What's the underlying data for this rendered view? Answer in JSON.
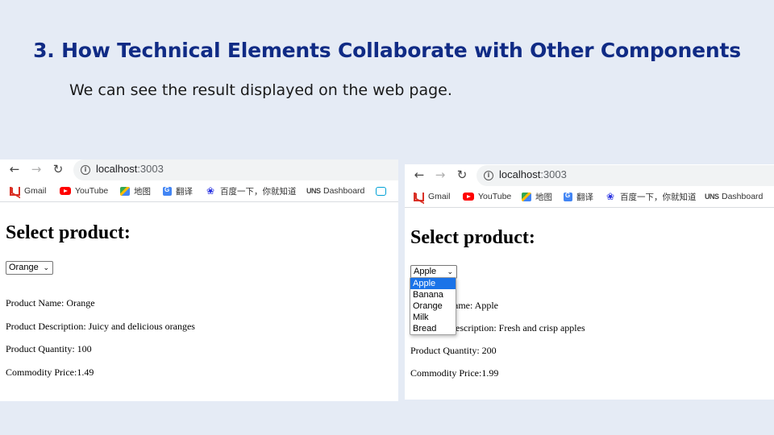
{
  "slide": {
    "title": "3. How Technical Elements Collaborate with Other Components",
    "subtitle": "We can see the result displayed on the web page."
  },
  "browser": {
    "back_icon": "arrow-left-icon",
    "forward_icon": "arrow-right-icon",
    "reload_icon": "reload-icon",
    "url_host": "localhost",
    "url_port": ":3003",
    "bookmarks": [
      "Gmail",
      "YouTube",
      "地图",
      "翻译",
      "百度一下，你就知道",
      "Dashboard"
    ],
    "bookmark_icons": [
      "gmail-icon",
      "youtube-icon",
      "maps-icon",
      "translate-icon",
      "baidu-icon",
      "dashboard-icon"
    ]
  },
  "left_page": {
    "heading": "Select product:",
    "selected": "Orange",
    "name_line": "Product Name: Orange",
    "desc_line": "Product Description: Juicy and delicious oranges",
    "qty_line": "Product Quantity: 100",
    "price_line": "Commodity Price:1.49"
  },
  "right_page": {
    "heading": "Select product:",
    "selected": "Apple",
    "options": [
      "Apple",
      "Banana",
      "Orange",
      "Milk",
      "Bread"
    ],
    "name_line_visible": "ame: Apple",
    "desc_line_visible": "escription: Fresh and crisp apples",
    "qty_line": "Product Quantity: 200",
    "price_line": "Commodity Price:1.99"
  },
  "colors": {
    "slide_background": "#e5ebf5",
    "title_color": "#102b85",
    "dropdown_highlight": "#1a73e8"
  }
}
